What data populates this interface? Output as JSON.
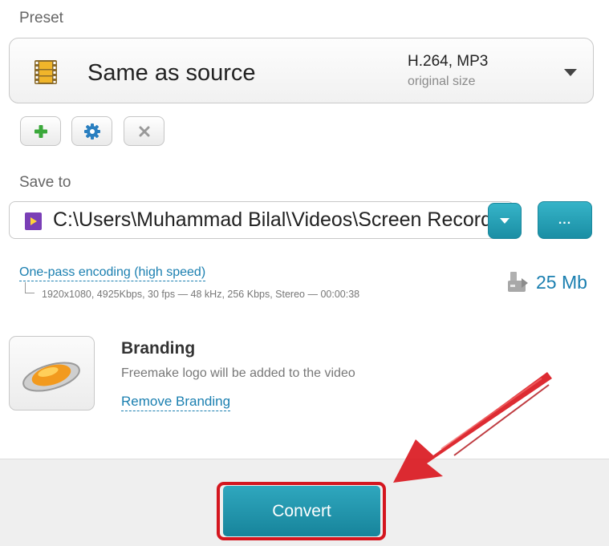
{
  "preset": {
    "section_label": "Preset",
    "name": "Same as source",
    "codec": "H.264, MP3",
    "size": "original size",
    "icon": "film-icon"
  },
  "preset_actions": {
    "add_icon": "plus-icon",
    "settings_icon": "gear-icon",
    "delete_icon": "close-icon"
  },
  "save_to": {
    "section_label": "Save to",
    "path": "C:\\Users\\Muhammad Bilal\\Videos\\Screen Recordings\\",
    "browse_label": "..."
  },
  "encoding": {
    "mode_link": "One-pass encoding (high speed)",
    "details": "1920x1080, 4925Kbps, 30 fps — 48 kHz, 256 Kbps, Stereo — 00:00:38",
    "file_size": "25 Mb"
  },
  "branding": {
    "title": "Branding",
    "description": "Freemake logo will be added to the video",
    "remove_link": "Remove Branding"
  },
  "footer": {
    "convert_label": "Convert"
  },
  "colors": {
    "accent_teal": "#1a8ea4",
    "link_blue": "#1a7fb0",
    "highlight_red": "#d4161f"
  }
}
